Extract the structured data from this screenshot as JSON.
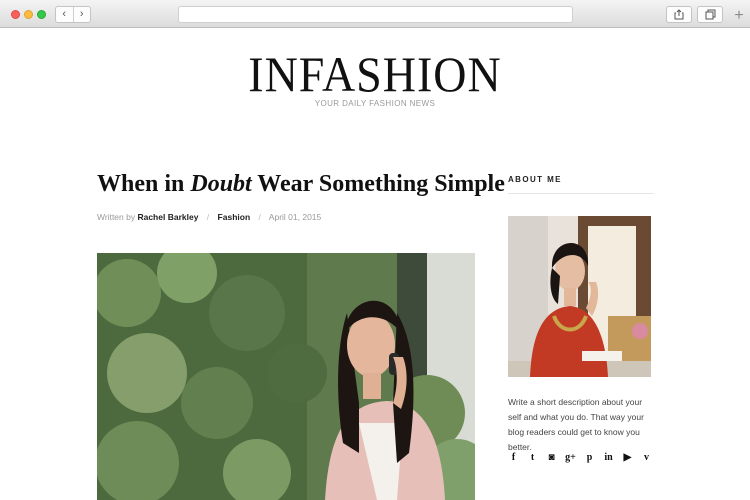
{
  "browser": {
    "back_icon": "chevron-left-icon",
    "forward_icon": "chevron-right-icon",
    "share_icon": "share-icon",
    "tabs_icon": "tabs-icon",
    "new_tab_icon": "plus-icon"
  },
  "site": {
    "logo": "INFASHION",
    "tagline": "YOUR DAILY FASHION NEWS"
  },
  "post": {
    "title_before": "When in ",
    "title_emphasis": "Doubt",
    "title_after": " Wear Something Simple",
    "meta_prefix": "Written by ",
    "author": "Rachel Barkley",
    "separator": "/",
    "category": "Fashion",
    "date": "April 01, 2015"
  },
  "sidebar": {
    "about_title": "ABOUT ME",
    "about_text": "Write a short description about your self and what you do. That way your blog readers could get to know you better.",
    "socials": [
      {
        "icon": "facebook-icon",
        "glyph": "f"
      },
      {
        "icon": "twitter-icon",
        "glyph": "t"
      },
      {
        "icon": "instagram-icon",
        "glyph": "◙"
      },
      {
        "icon": "google-plus-icon",
        "glyph": "g+"
      },
      {
        "icon": "pinterest-icon",
        "glyph": "p"
      },
      {
        "icon": "linkedin-icon",
        "glyph": "in"
      },
      {
        "icon": "youtube-icon",
        "glyph": "▶"
      },
      {
        "icon": "vimeo-icon",
        "glyph": "v"
      }
    ]
  }
}
